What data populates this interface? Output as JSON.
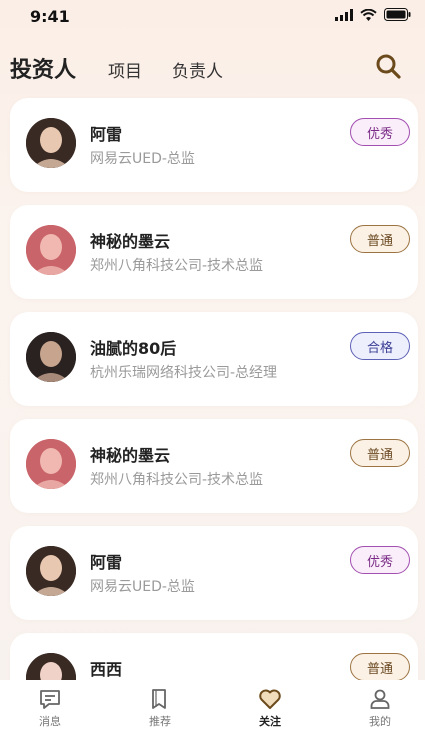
{
  "status": {
    "time": "9:41"
  },
  "header": {
    "tabs": [
      "投资人",
      "项目",
      "负责人"
    ]
  },
  "cards": [
    {
      "name": "阿雷",
      "title": "网易云UED-总监",
      "badge": "优秀",
      "badge_type": "excellent"
    },
    {
      "name": "神秘的墨云",
      "title": "郑州八角科技公司-技术总监",
      "badge": "普通",
      "badge_type": "normal"
    },
    {
      "name": "油腻的80后",
      "title": "杭州乐瑞网络科技公司-总经理",
      "badge": "合格",
      "badge_type": "pass"
    },
    {
      "name": "神秘的墨云",
      "title": "郑州八角科技公司-技术总监",
      "badge": "普通",
      "badge_type": "normal"
    },
    {
      "name": "阿雷",
      "title": "网易云UED-总监",
      "badge": "优秀",
      "badge_type": "excellent"
    },
    {
      "name": "西西",
      "title": "",
      "badge": "普通",
      "badge_type": "normal"
    }
  ],
  "tabbar": {
    "items": [
      {
        "label": "消息",
        "icon": "message-icon"
      },
      {
        "label": "推荐",
        "icon": "bookmark-icon"
      },
      {
        "label": "关注",
        "icon": "heart-icon",
        "active": true
      },
      {
        "label": "我的",
        "icon": "user-icon"
      }
    ]
  }
}
